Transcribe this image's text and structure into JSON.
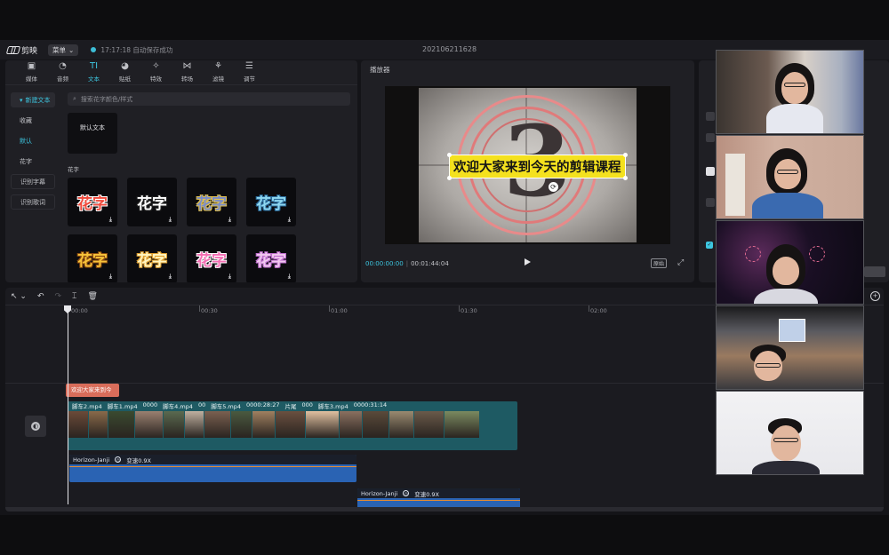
{
  "window": {
    "app_name": "剪映",
    "menu_label": "菜单",
    "save_status": "17:17:18 自动保存成功",
    "project_title": "202106211628"
  },
  "toolbar": {
    "tabs": [
      {
        "label": "媒体",
        "icon": "▣",
        "icon_name": "media-icon"
      },
      {
        "label": "音频",
        "icon": "◔",
        "icon_name": "audio-icon"
      },
      {
        "label": "文本",
        "icon": "TI",
        "icon_name": "text-icon"
      },
      {
        "label": "贴纸",
        "icon": "◕",
        "icon_name": "sticker-icon"
      },
      {
        "label": "特效",
        "icon": "✧",
        "icon_name": "effects-icon"
      },
      {
        "label": "转场",
        "icon": "⋈",
        "icon_name": "transition-icon"
      },
      {
        "label": "滤镜",
        "icon": "⚘",
        "icon_name": "filter-icon"
      },
      {
        "label": "调节",
        "icon": "☰",
        "icon_name": "adjust-icon"
      }
    ],
    "active_index": 2
  },
  "text_sidebar": {
    "items": [
      "新建文本",
      "收藏",
      "默认",
      "花字",
      "识别字幕",
      "识别歌词"
    ]
  },
  "text_library": {
    "search_placeholder": "搜索花字颜色/样式",
    "default_text_label": "默认文本",
    "fancy_section_label": "花字",
    "fancy_items": [
      {
        "text": "花字",
        "color": "#f04a3c",
        "stroke": "#ffffff"
      },
      {
        "text": "花字",
        "color": "#ffffff",
        "stroke": "#222222"
      },
      {
        "text": "花字",
        "color": "#7a8cc8",
        "stroke": "#e0c050"
      },
      {
        "text": "花字",
        "color": "#8fd8f0",
        "stroke": "#2a6a9a"
      },
      {
        "text": "花字",
        "color": "#f7c33a",
        "stroke": "#8a4a10"
      },
      {
        "text": "花字",
        "color": "#fff5c0",
        "stroke": "#e0a030"
      },
      {
        "text": "花字",
        "color": "#f56fb4",
        "stroke": "#ffffff"
      },
      {
        "text": "花字",
        "color": "#f2c8f0",
        "stroke": "#c070d0"
      }
    ]
  },
  "player": {
    "title": "播放器",
    "countdown_digit": "3",
    "subtitle": "欢迎大家来到今天的剪辑课程",
    "current_time": "00:00:00:00",
    "total_time": "00:01:44:04",
    "ratio_label": "原始",
    "colors": {
      "subtitle_bg": "#f4e11e",
      "accent": "#3dc6e0"
    }
  },
  "timeline": {
    "ruler_labels": [
      "00:00",
      "00:30",
      "01:00",
      "01:30",
      "02:00"
    ],
    "text_clip_label": "欢迎大家来到今",
    "video_clip_labels": [
      "脚车2.mp4",
      "脚车1.mp4",
      "0000",
      "脚车4.mp4",
      "00",
      "脚车5.mp4",
      "0000:28:27",
      "片尾",
      "000",
      "脚车3.mp4",
      "0000:31:14"
    ],
    "audio_clips": [
      {
        "name": "Horizon-Janji",
        "speed": "变速0.9X"
      },
      {
        "name": "Horizon-Janji",
        "speed": "变速0.9X"
      }
    ]
  }
}
